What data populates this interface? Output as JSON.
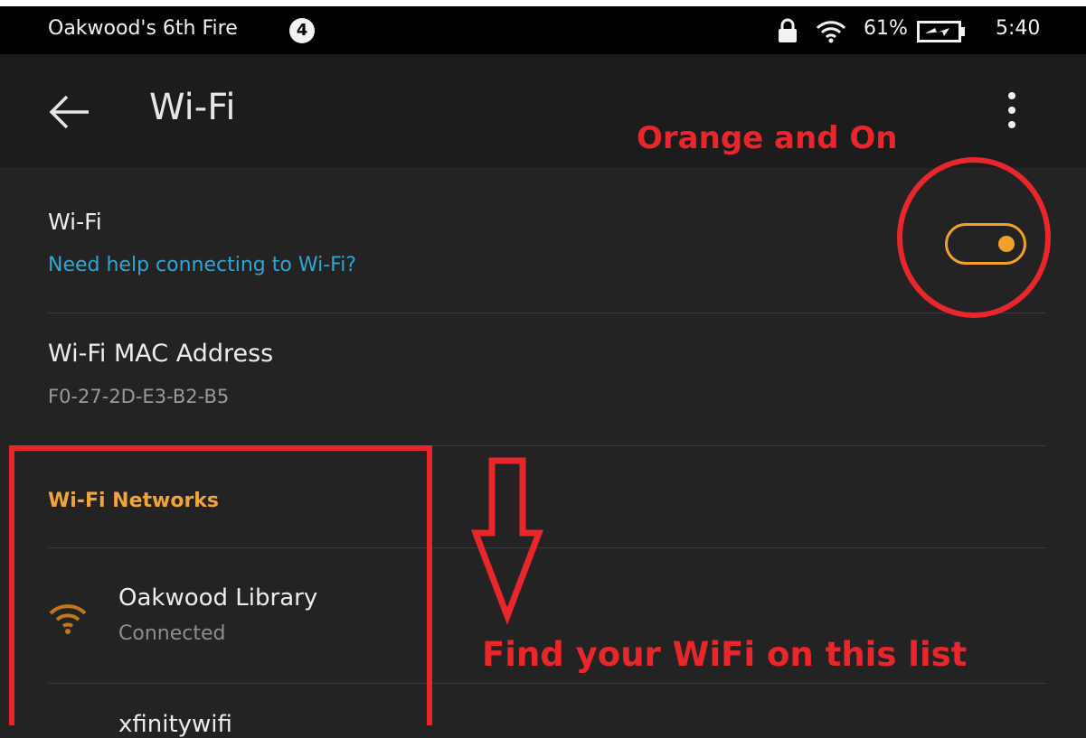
{
  "status_bar": {
    "device_name": "Oakwood's 6th Fire",
    "notification_count": "4",
    "battery_percent": "61%",
    "time": "5:40",
    "icons": [
      "lock-icon",
      "wifi-signal-icon",
      "battery-charging-icon"
    ]
  },
  "app_bar": {
    "title": "Wi-Fi",
    "icons": [
      "back-arrow-icon",
      "overflow-menu-icon"
    ]
  },
  "wifi_setting": {
    "label": "Wi-Fi",
    "help_link": "Need help connecting to Wi-Fi?",
    "toggle_on": true
  },
  "mac_address": {
    "label": "Wi-Fi MAC Address",
    "value": "F0-27-2D-E3-B2-B5"
  },
  "networks_section": {
    "header": "Wi-Fi Networks",
    "items": [
      {
        "name": "Oakwood Library",
        "status": "Connected",
        "icon": "wifi-signal-icon"
      },
      {
        "name": "xfinitywifi",
        "status": ""
      }
    ]
  },
  "annotations": {
    "toggle_note": "Orange and On",
    "list_note": "Find your WiFi on this list"
  },
  "colors": {
    "accent": "#f2a127",
    "link": "#2ea7d6",
    "annotation": "#e8262c",
    "background": "#232323"
  }
}
